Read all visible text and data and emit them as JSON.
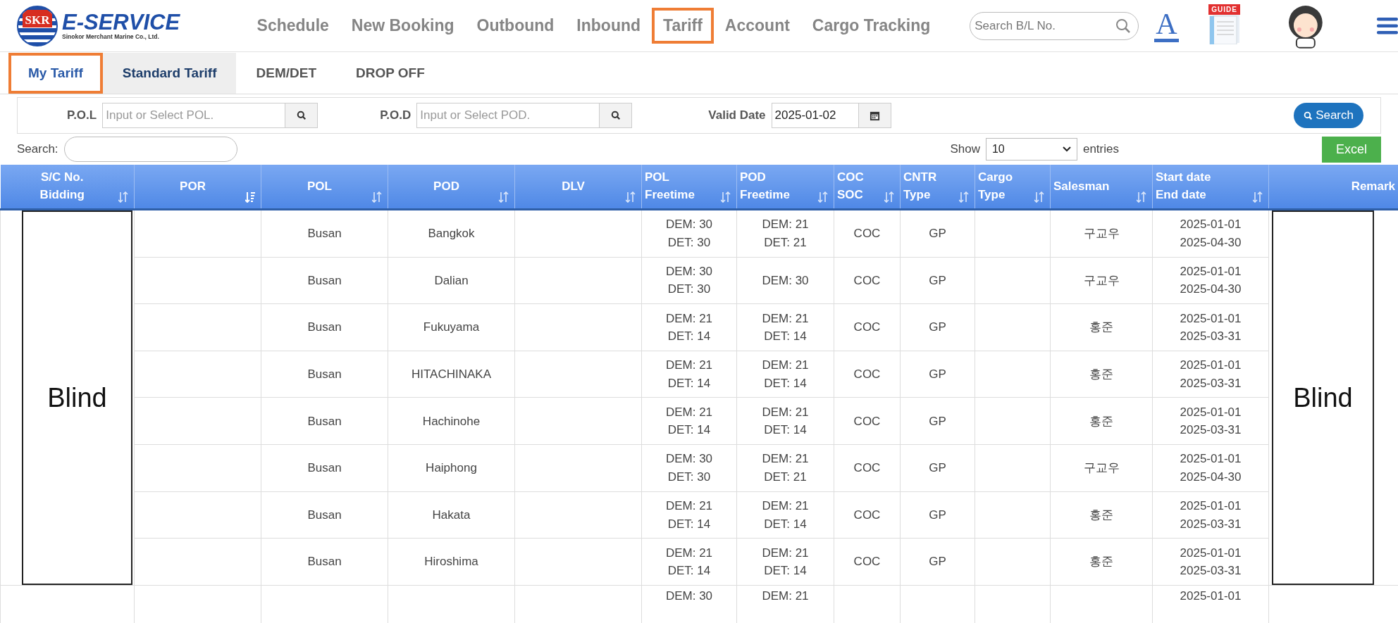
{
  "logo": {
    "mark": "SKR",
    "title": "E-SERVICE",
    "subtitle": "Sinokor Merchant Marine Co., Ltd."
  },
  "nav": [
    {
      "label": "Schedule",
      "highlighted": false
    },
    {
      "label": "New Booking",
      "highlighted": false
    },
    {
      "label": "Outbound",
      "highlighted": false
    },
    {
      "label": "Inbound",
      "highlighted": false
    },
    {
      "label": "Tariff",
      "highlighted": true
    },
    {
      "label": "Account",
      "highlighted": false
    },
    {
      "label": "Cargo Tracking",
      "highlighted": false
    }
  ],
  "bl_search": {
    "placeholder": "Search B/L No."
  },
  "font_button": "A",
  "guide_badge": "GUIDE",
  "tabs": [
    {
      "label": "My Tariff",
      "selected": true,
      "highlighted": true
    },
    {
      "label": "Standard Tariff",
      "selected": false,
      "highlighted": false
    },
    {
      "label": "DEM/DET",
      "selected": false,
      "highlighted": false
    },
    {
      "label": "DROP OFF",
      "selected": false,
      "highlighted": false
    }
  ],
  "filters": {
    "pol_label": "P.O.L",
    "pol_placeholder": "Input or Select POL.",
    "pod_label": "P.O.D",
    "pod_placeholder": "Input or Select POD.",
    "date_label": "Valid Date",
    "date_value": "2025-01-02",
    "search_button": "Search"
  },
  "table_search_label": "Search:",
  "show_label": "Show",
  "show_value": "10",
  "entries_label": "entries",
  "excel_button": "Excel",
  "columns": [
    {
      "label": "S/C No.\nBidding",
      "sorted": false
    },
    {
      "label": "POR",
      "sorted": true
    },
    {
      "label": "POL",
      "sorted": false
    },
    {
      "label": "POD",
      "sorted": false
    },
    {
      "label": "DLV",
      "sorted": false
    },
    {
      "label": "POL\nFreetime",
      "sorted": false
    },
    {
      "label": "POD\nFreetime",
      "sorted": false
    },
    {
      "label": "COC\nSOC",
      "sorted": false
    },
    {
      "label": "CNTR\nType",
      "sorted": false
    },
    {
      "label": "Cargo\nType",
      "sorted": false
    },
    {
      "label": "Salesman",
      "sorted": false
    },
    {
      "label": "Start date\nEnd date",
      "sorted": false
    },
    {
      "label": "Remark"
    }
  ],
  "blind_left": "Blind",
  "blind_right": "Blind",
  "rows": [
    {
      "pol": "Busan",
      "pod": "Bangkok",
      "pol_freetime": "DEM: 30\nDET: 30",
      "pod_freetime": "DEM: 21\nDET: 21",
      "coc_soc": "COC",
      "cntr_type": "GP",
      "salesman": "구교우",
      "dates": "2025-01-01\n2025-04-30"
    },
    {
      "pol": "Busan",
      "pod": "Dalian",
      "pol_freetime": "DEM: 30\nDET: 30",
      "pod_freetime": "DEM: 30",
      "coc_soc": "COC",
      "cntr_type": "GP",
      "salesman": "구교우",
      "dates": "2025-01-01\n2025-04-30"
    },
    {
      "pol": "Busan",
      "pod": "Fukuyama",
      "pol_freetime": "DEM: 21\nDET: 14",
      "pod_freetime": "DEM: 21\nDET: 14",
      "coc_soc": "COC",
      "cntr_type": "GP",
      "salesman": "홍준",
      "dates": "2025-01-01\n2025-03-31"
    },
    {
      "pol": "Busan",
      "pod": "HITACHINAKA",
      "pol_freetime": "DEM: 21\nDET: 14",
      "pod_freetime": "DEM: 21\nDET: 14",
      "coc_soc": "COC",
      "cntr_type": "GP",
      "salesman": "홍준",
      "dates": "2025-01-01\n2025-03-31"
    },
    {
      "pol": "Busan",
      "pod": "Hachinohe",
      "pol_freetime": "DEM: 21\nDET: 14",
      "pod_freetime": "DEM: 21\nDET: 14",
      "coc_soc": "COC",
      "cntr_type": "GP",
      "salesman": "홍준",
      "dates": "2025-01-01\n2025-03-31"
    },
    {
      "pol": "Busan",
      "pod": "Haiphong",
      "pol_freetime": "DEM: 30\nDET: 30",
      "pod_freetime": "DEM: 21\nDET: 21",
      "coc_soc": "COC",
      "cntr_type": "GP",
      "salesman": "구교우",
      "dates": "2025-01-01\n2025-04-30"
    },
    {
      "pol": "Busan",
      "pod": "Hakata",
      "pol_freetime": "DEM: 21\nDET: 14",
      "pod_freetime": "DEM: 21\nDET: 14",
      "coc_soc": "COC",
      "cntr_type": "GP",
      "salesman": "홍준",
      "dates": "2025-01-01\n2025-03-31"
    },
    {
      "pol": "Busan",
      "pod": "Hiroshima",
      "pol_freetime": "DEM: 21\nDET: 14",
      "pod_freetime": "DEM: 21\nDET: 14",
      "coc_soc": "COC",
      "cntr_type": "GP",
      "salesman": "홍준",
      "dates": "2025-01-01\n2025-03-31"
    },
    {
      "pol_freetime": "DEM: 30",
      "pod_freetime": "DEM: 21",
      "dates": "2025-01-01"
    }
  ]
}
